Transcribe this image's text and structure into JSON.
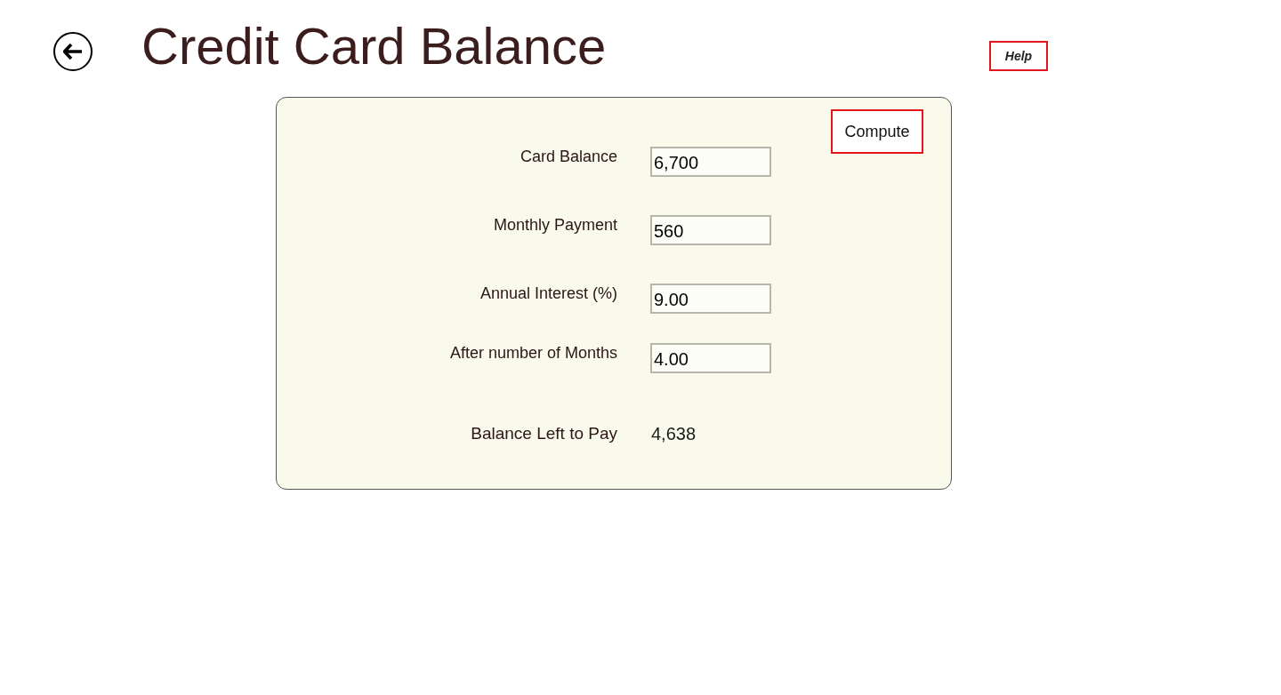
{
  "header": {
    "title": "Credit Card Balance",
    "help_button": "Help"
  },
  "form": {
    "compute_button": "Compute",
    "fields": [
      {
        "label": "Card Balance",
        "value": "6,700"
      },
      {
        "label": "Monthly Payment",
        "value": "560"
      },
      {
        "label": "Annual Interest (%)",
        "value": "9.00"
      },
      {
        "label": "After number of Months",
        "value": "4.00"
      }
    ],
    "result": {
      "label": "Balance Left to Pay",
      "value": "4,638"
    }
  }
}
